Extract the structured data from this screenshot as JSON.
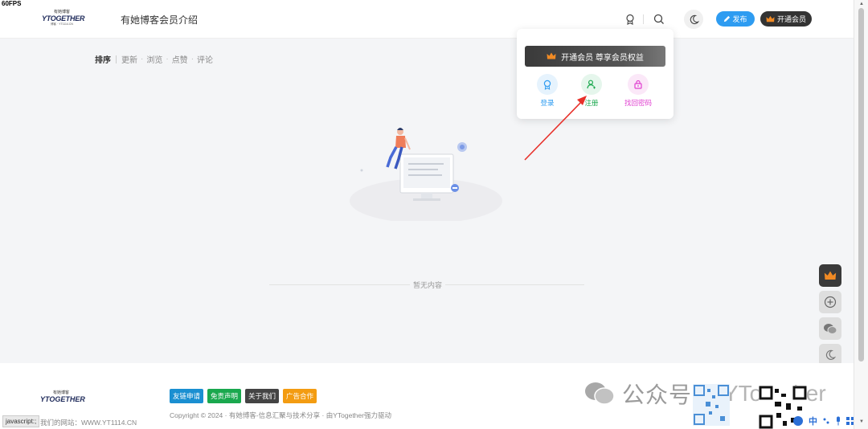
{
  "fps": "60FPS",
  "header": {
    "logo": {
      "cn": "有她博客",
      "en": "YTOGETHER",
      "sub": "博客 · YT1114.CN"
    },
    "nav_title": "有她博客会员介绍",
    "publish_label": "发布",
    "vip_label": "开通会员"
  },
  "sort": {
    "items": [
      "排序",
      "更新",
      "浏览",
      "点赞",
      "评论"
    ]
  },
  "empty": {
    "text": "暂无内容"
  },
  "popup": {
    "vip_banner": "开通会员 尊享会员权益",
    "items": [
      {
        "label": "登录",
        "color": "#2e9cf1",
        "bg": "#e6f3fd"
      },
      {
        "label": "注册",
        "color": "#1aa84e",
        "bg": "#e5f6ec"
      },
      {
        "label": "找回密码",
        "color": "#e040d0",
        "bg": "#fbe8f8"
      }
    ]
  },
  "footer": {
    "tags": [
      {
        "label": "友链申请",
        "color": "#1a8fd1"
      },
      {
        "label": "免责声明",
        "color": "#1aa84e"
      },
      {
        "label": "关于我们",
        "color": "#444444"
      },
      {
        "label": "广告合作",
        "color": "#f39c12"
      }
    ],
    "copyright": "Copyright © 2024 · 有她博客-信息汇聚与技术分享 · 由YTogether强力驱动",
    "site": "我们的网站：WWW.YT1114.CN",
    "status": "javascript:;"
  },
  "watermark": {
    "text": "公众号",
    "brand": "YTogether"
  },
  "tray": {
    "ime": "中"
  }
}
